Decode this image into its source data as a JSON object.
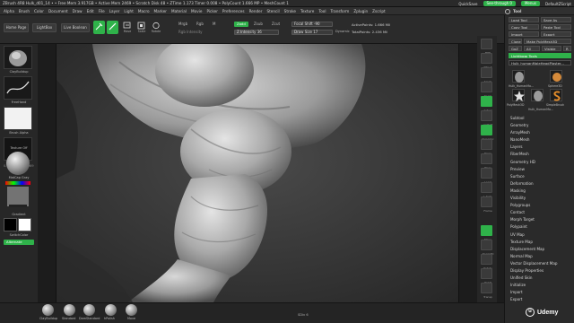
{
  "titlebar": {
    "text": "ZBrush 4R8   Hulk_d01_14 •  • Free Mem 3.917GB • Active Mem 2469 • Scratch Disk 48 •  ZTime 1.173 Timer 0.008 • PolyCount 1.666 MP • MeshCount 1",
    "quicksave": "QuickSave",
    "see_through": "See-through  0",
    "menus_label": "Menus",
    "default_zscript": "DefaultZScript"
  },
  "menubar": {
    "items": [
      "Alpha",
      "Brush",
      "Color",
      "Document",
      "Draw",
      "Edit",
      "File",
      "Layer",
      "Light",
      "Macro",
      "Marker",
      "Material",
      "Movie",
      "Picker",
      "Preferences",
      "Render",
      "Stencil",
      "Stroke",
      "Texture",
      "Tool",
      "Transform",
      "Zplugin",
      "Zscript"
    ],
    "tool_tab": "Tool"
  },
  "topshelf": {
    "home_page": "Home Page",
    "lightbox": "LightBox",
    "live_boolean": "Live Boolean",
    "edit": "Edit",
    "draw": "Draw",
    "move": "Move",
    "scale": "Scale",
    "rotate": "Rotate",
    "mrgb": "Mrgb",
    "rgb": "Rgb",
    "m": "M",
    "zadd": "Zadd",
    "zsub": "Zsub",
    "zcut": "Zcut",
    "rgb_intensity": "Rgb Intensity",
    "z_intensity": "Z Intensity 36",
    "focal_shift": "Focal Shift -90",
    "draw_size": "Draw Size 17",
    "dynamic": "Dynamic",
    "active_points": "ActivePoints: 1.666 Mil",
    "total_points": "TotalPoints: 2.436 Mil",
    "coords": "0.378,-0.743,0.069"
  },
  "leftpanel": {
    "brush_label": "ClayBuildup",
    "stroke_label": "FreeHand",
    "alpha_label": "Brush Alpha",
    "texture_label": "Texture Off",
    "material_label": "MatCap Gray",
    "gradient_label": "Gradient",
    "switch_color_label": "SwitchColor",
    "alternate_label": "Alternate",
    "main_color": "#000000",
    "secondary_color": "#ffffff"
  },
  "vshelf": {
    "buttons": [
      "BPR",
      "SPix 3",
      "Scroll",
      "Zoom",
      "Actual",
      "AAHalf",
      "Dynamic",
      "Persp",
      "Floor",
      "Local",
      "L.Sym",
      "Frame",
      "Move",
      "Zoom3D",
      "Rotate",
      "PolyF",
      "Transp",
      "Ghost",
      "Solo",
      "Xpose"
    ]
  },
  "rightpanel": {
    "load_tool": "Load Tool",
    "save_as": "Save As",
    "copy_tool": "Copy Tool",
    "paste_tool": "Paste Tool",
    "import": "Import",
    "export": "Export",
    "clone": "Clone",
    "make_polymesh": "Make PolyMesh3D",
    "goz": "GoZ",
    "all": "All",
    "visible": "Visible",
    "r": "R",
    "lightbox_tools": "Lightbox▸ Tools",
    "current_tool": "Hulk_humanMaleHeadPlaster...",
    "subtools": [
      {
        "label": "Hulk_HumanMa...",
        "icon": "head-icon"
      },
      {
        "label": "Sphere3D",
        "icon": "sphere-icon"
      },
      {
        "label": "PolyMesh3D",
        "icon": "star-icon"
      },
      {
        "label": "SimpleBrush",
        "icon": "s-brush-icon"
      },
      {
        "label": "Hulk_HumanMa...",
        "icon": "head-icon"
      }
    ],
    "menu_items": [
      "Subtool",
      "Geometry",
      "ArrayMesh",
      "NanoMesh",
      "Layers",
      "FiberMesh",
      "Geometry HD",
      "Preview",
      "Surface",
      "Deformation",
      "Masking",
      "Visibility",
      "Polygroups",
      "Contact",
      "Morph Target",
      "Polypaint",
      "UV Map",
      "Texture Map",
      "Displacement Map",
      "Normal Map",
      "Vector Displacement Map",
      "Display Properties",
      "Unified Skin",
      "Initialize",
      "Import",
      "Export"
    ]
  },
  "bottombar": {
    "brushes": [
      "ClayBuildup",
      "Standard",
      "DamStandard",
      "hPolish",
      "Move"
    ],
    "center_label": "SDiv 6"
  },
  "watermark": "Udemy",
  "colors": {
    "accent_green": "#2fb24a",
    "bg": "#1c1c1c",
    "panel": "#2a2a2a"
  }
}
